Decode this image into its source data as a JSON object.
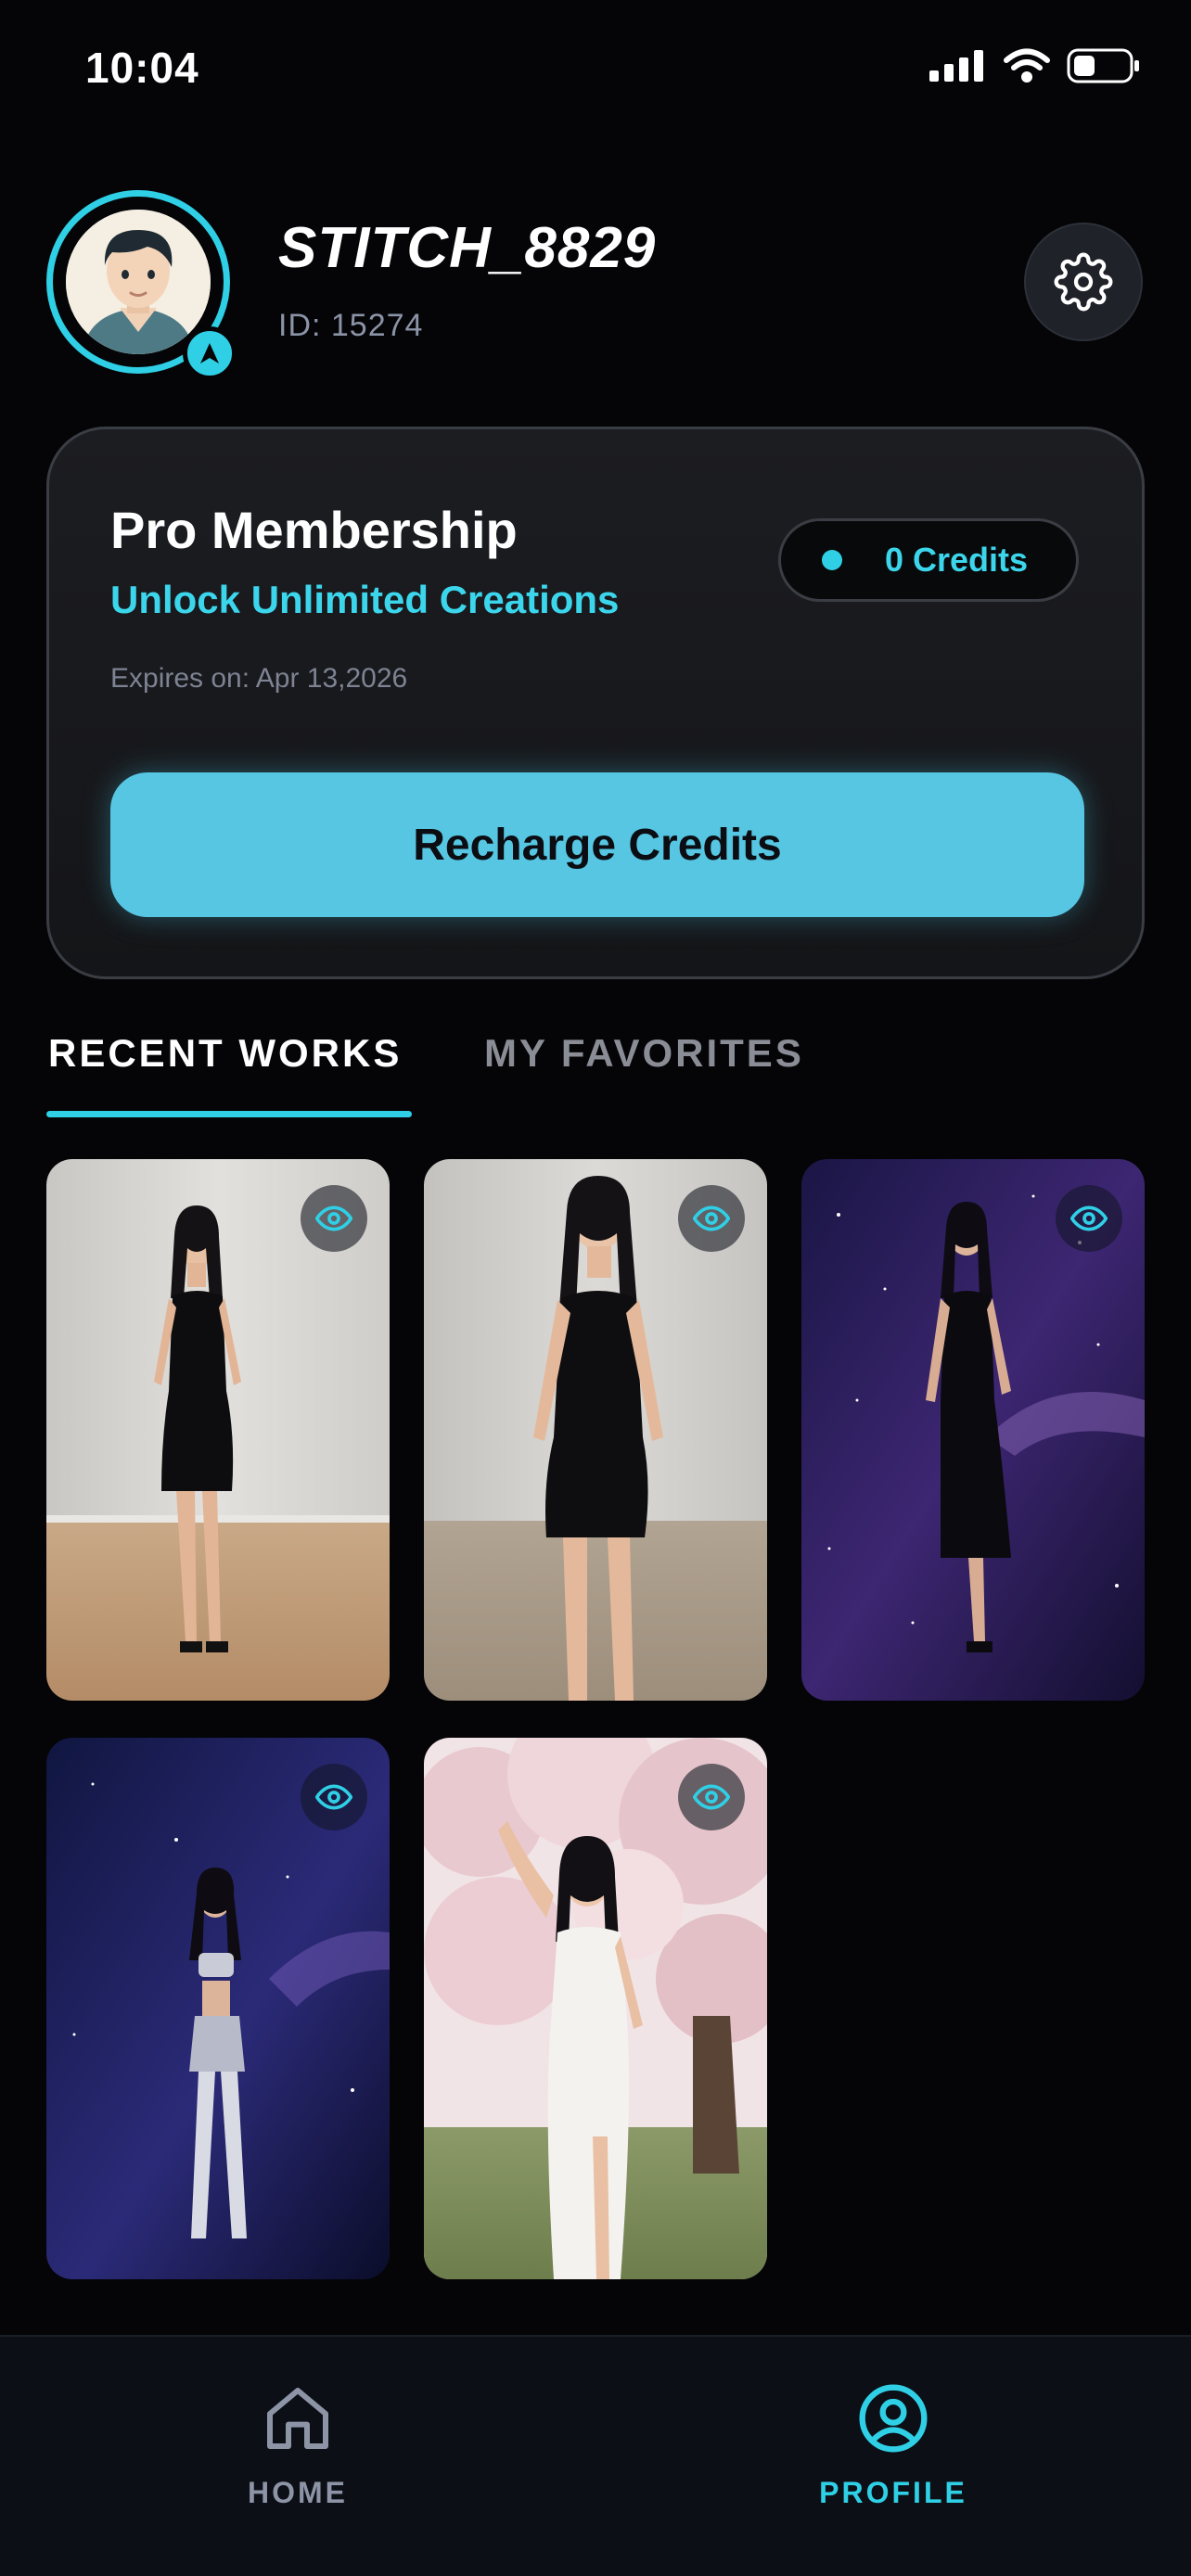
{
  "status_bar": {
    "time": "10:04",
    "icons": [
      "signal-icon",
      "wifi-icon",
      "battery-icon"
    ]
  },
  "profile": {
    "username": "STITCH_8829",
    "id_text": "ID: 15274",
    "settings_icon": "gear-icon"
  },
  "membership": {
    "title": "Pro Membership",
    "subtitle": "Unlock Unlimited Creations",
    "expiry": "Expires on: Apr 13,2026",
    "credits": "0 Credits",
    "recharge_label": "Recharge Credits"
  },
  "tabs": [
    {
      "label": "RECENT WORKS",
      "active": true
    },
    {
      "label": "MY FAVORITES",
      "active": false
    }
  ],
  "works": [
    {
      "scene": "studio-black-dress"
    },
    {
      "scene": "studio-black-dress"
    },
    {
      "scene": "galaxy-black-dress"
    },
    {
      "scene": "galaxy-silver-outfit"
    },
    {
      "scene": "cherry-blossom-white-dress"
    }
  ],
  "bottom_nav": [
    {
      "label": "HOME",
      "icon": "home-icon",
      "active": false
    },
    {
      "label": "PROFILE",
      "icon": "user-circle-icon",
      "active": true
    }
  ],
  "colors": {
    "accent": "#2fd0e6",
    "button": "#56c6e2",
    "background": "#050507"
  }
}
